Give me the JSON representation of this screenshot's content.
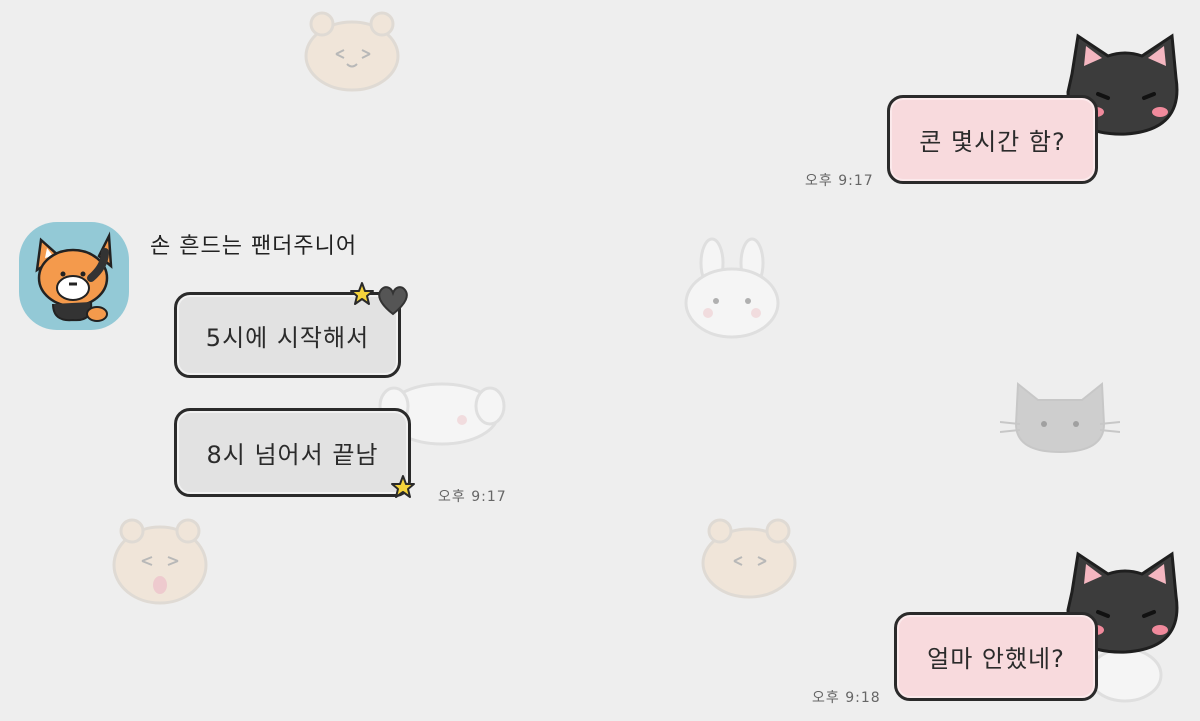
{
  "chat": {
    "messages": [
      {
        "sender": "me",
        "text": "콘 몇시간 함?",
        "time": "오후 9:17"
      },
      {
        "sender": "other",
        "text": "5시에 시작해서"
      },
      {
        "sender": "other",
        "text": "8시 넘어서 끝남",
        "time": "오후 9:17"
      },
      {
        "sender": "me",
        "text": "얼마 안했네?",
        "time": "오후 9:18"
      }
    ],
    "other_user": {
      "name": "손 흔드는 팬더주니어",
      "avatar_icon": "red-panda-avatar-icon"
    }
  },
  "theme": {
    "background": "#eeeeee",
    "my_bubble_color": "#f8dadd",
    "their_bubble_color": "#e2e2e2",
    "bubble_border": "#2a2a2a",
    "avatar_bg": "#93c9d6"
  },
  "decorations": [
    "black-cat-icon",
    "star-icon",
    "heart-icon",
    "hamster-icon",
    "bunny-icon",
    "gray-cat-icon",
    "puppy-icon"
  ]
}
